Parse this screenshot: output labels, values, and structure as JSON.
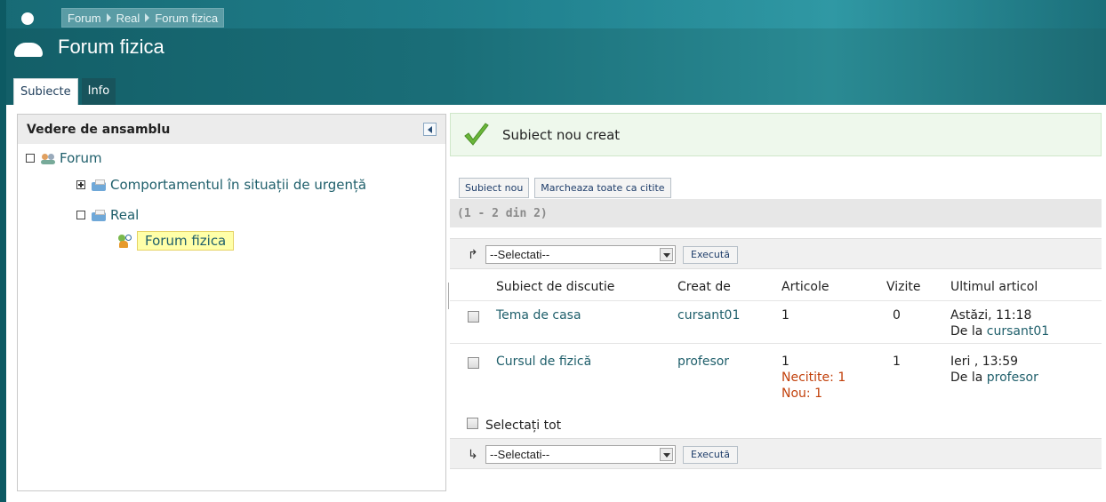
{
  "header": {
    "breadcrumb": [
      "Forum",
      "Real",
      "Forum fizica"
    ],
    "title": "Forum fizica"
  },
  "tabs": [
    {
      "label": "Subiecte",
      "active": true
    },
    {
      "label": "Info",
      "active": false
    }
  ],
  "tree": {
    "title": "Vedere de ansamblu",
    "nodes": {
      "forum": "Forum",
      "comportament": "Comportamentul în situații de urgență",
      "real": "Real",
      "forum_fizica": "Forum fizica"
    }
  },
  "message": {
    "text": "Subiect nou creat"
  },
  "actions": {
    "new_topic": "Subiect nou",
    "mark_all_read": "Marcheaza toate ca citite"
  },
  "range_text": "(1 - 2 din 2)",
  "toolbar": {
    "select_placeholder": "--Selectati--",
    "execute_label": "Execută"
  },
  "table": {
    "headers": {
      "subject": "Subiect de discutie",
      "created_by": "Creat de",
      "articles": "Articole",
      "visits": "Vizite",
      "last_article": "Ultimul articol"
    },
    "rows": [
      {
        "subject": "Tema de casa",
        "created_by": "cursant01",
        "articles": "1",
        "unread": "",
        "new": "",
        "visits": "0",
        "last_time": "Astăzi, 11:18",
        "last_prefix": "De la",
        "last_user": "cursant01"
      },
      {
        "subject": "Cursul de fizică",
        "created_by": "profesor",
        "articles": "1",
        "unread": "Necitite: 1",
        "new": "Nou: 1",
        "visits": "1",
        "last_time": "Ieri , 13:59",
        "last_prefix": "De la",
        "last_user": "profesor"
      }
    ],
    "select_all": "Selectați tot"
  },
  "colors": {
    "header_bg": "#135f68",
    "link": "#1f5f6b",
    "unread": "#c2410c",
    "success_bg": "#eef8ec"
  },
  "icons": [
    "user-icon",
    "collapse-left-icon",
    "forum-group-icon",
    "folder-icon",
    "topic-icon",
    "checkmark-icon",
    "dropdown-arrow-icon"
  ]
}
